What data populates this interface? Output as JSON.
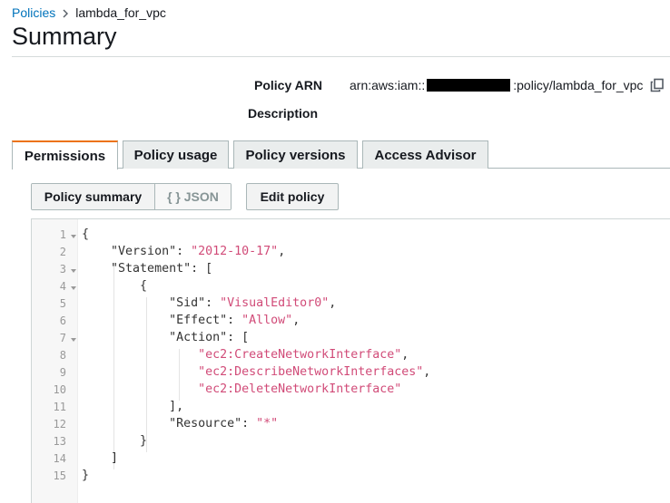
{
  "breadcrumb": {
    "parent": "Policies",
    "current": "lambda_for_vpc"
  },
  "page": {
    "title": "Summary"
  },
  "summary": {
    "arn_label": "Policy ARN",
    "arn_prefix": "arn:aws:iam::",
    "arn_suffix": ":policy/lambda_for_vpc",
    "description_label": "Description"
  },
  "tabs": [
    {
      "label": "Permissions",
      "active": true
    },
    {
      "label": "Policy usage",
      "active": false
    },
    {
      "label": "Policy versions",
      "active": false
    },
    {
      "label": "Access Advisor",
      "active": false
    }
  ],
  "toolbar": {
    "policy_summary_label": "Policy summary",
    "json_label": "{ } JSON",
    "edit_policy_label": "Edit policy"
  },
  "editor": {
    "line_numbers": [
      "1",
      "2",
      "3",
      "4",
      "5",
      "6",
      "7",
      "8",
      "9",
      "10",
      "11",
      "12",
      "13",
      "14",
      "15"
    ],
    "folds": [
      "1",
      "3",
      "4",
      "7"
    ],
    "tokens": {
      "l1": "{",
      "version_key": "\"Version\"",
      "version_sep": ": ",
      "version_val": "\"2012-10-17\"",
      "version_end": ",",
      "statement_key": "\"Statement\"",
      "statement_sep": ": [",
      "l4": "{",
      "sid_key": "\"Sid\"",
      "sid_sep": ": ",
      "sid_val": "\"VisualEditor0\"",
      "sid_end": ",",
      "effect_key": "\"Effect\"",
      "effect_sep": ": ",
      "effect_val": "\"Allow\"",
      "effect_end": ",",
      "action_key": "\"Action\"",
      "action_sep": ": [",
      "action1": "\"ec2:CreateNetworkInterface\"",
      "action1_end": ",",
      "action2": "\"ec2:DescribeNetworkInterfaces\"",
      "action2_end": ",",
      "action3": "\"ec2:DeleteNetworkInterface\"",
      "l11": "],",
      "resource_key": "\"Resource\"",
      "resource_sep": ": ",
      "resource_val": "\"*\"",
      "l13": "}",
      "l14": "]",
      "l15": "}"
    }
  },
  "colors": {
    "link": "#0073bb",
    "active_tab_accent": "#ec7211",
    "json_string": "#d14b78"
  }
}
